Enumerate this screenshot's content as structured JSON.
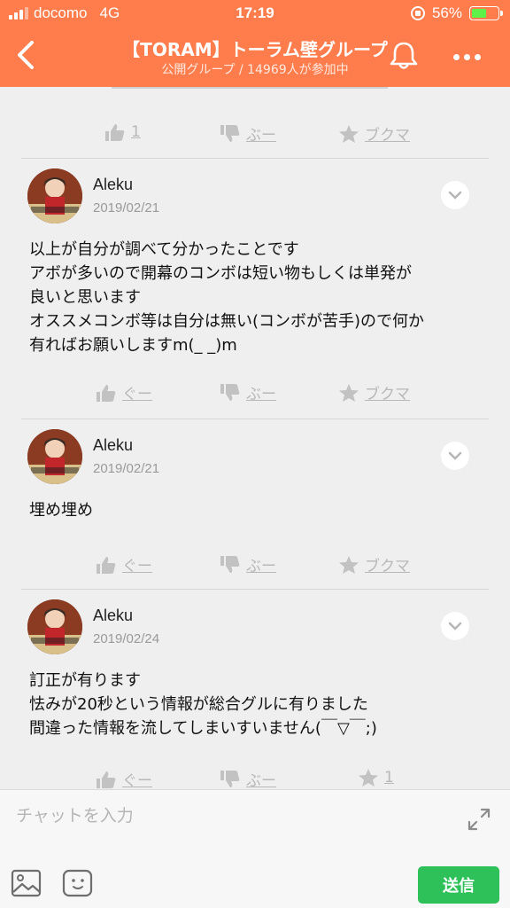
{
  "status_bar": {
    "carrier": "docomo",
    "network": "4G",
    "time": "17:19",
    "battery_percent": "56%",
    "battery_level": 0.56
  },
  "header": {
    "title": "【TORAM】トーラム壁グループ",
    "subtitle": "公開グループ / 14969人が参加中",
    "back_icon": "chevron-left-icon",
    "bell_icon": "bell-icon",
    "more_icon": "more-dots-icon"
  },
  "first_actions": {
    "like": "1",
    "dislike": "ぶー",
    "bookmark": "ブクマ"
  },
  "posts": [
    {
      "author": "Aleku",
      "date": "2019/02/21",
      "text": "以上が自分が調べて分かったことです\nアボが多いので開幕のコンボは短い物もしくは単発が\n良いと思います\nオススメコンボ等は自分は無い(コンボが苦手)ので何か\n有ればお願いしますm(_ _)m",
      "like": "ぐー",
      "dislike": "ぶー",
      "bookmark": "ブクマ"
    },
    {
      "author": "Aleku",
      "date": "2019/02/21",
      "text": "埋め埋め",
      "like": "ぐー",
      "dislike": "ぶー",
      "bookmark": "ブクマ"
    },
    {
      "author": "Aleku",
      "date": "2019/02/24",
      "text": "訂正が有ります\n怯みが20秒という情報が総合グルに有りました\n間違った情報を流してしまいすいません(￣▽￣;)",
      "like": "ぐー",
      "dislike": "ぶー",
      "bookmark": "1"
    }
  ],
  "chat": {
    "placeholder": "チャットを入力",
    "send_label": "送信"
  },
  "colors": {
    "header": "#ff7c4c",
    "send": "#2ec15a",
    "background": "#efefef"
  }
}
